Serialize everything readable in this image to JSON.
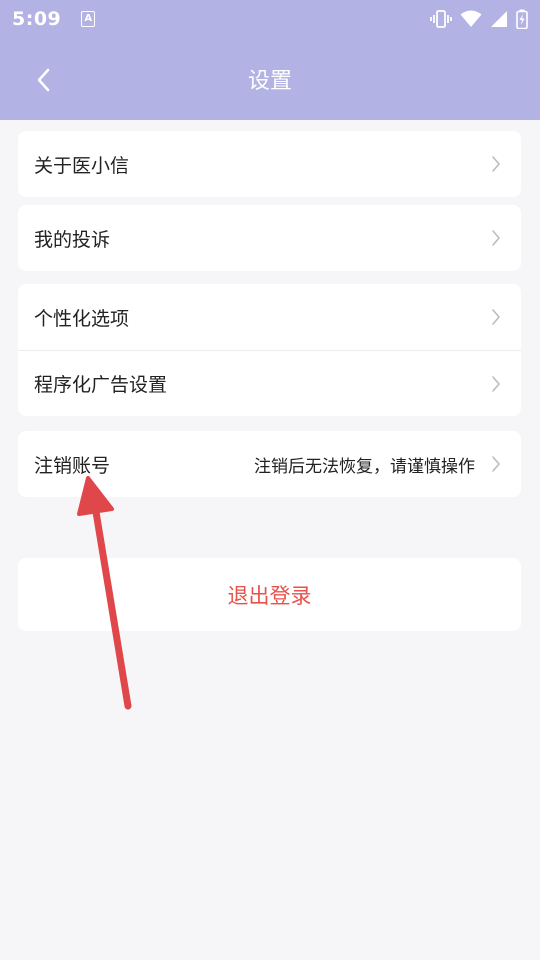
{
  "status_bar": {
    "time": "5:09",
    "notification_icon": "a-badge-icon",
    "icons": [
      "vibrate-icon",
      "wifi-icon",
      "signal-icon",
      "battery-charging-icon"
    ]
  },
  "app_bar": {
    "back_icon": "chevron-left-icon",
    "title": "设置"
  },
  "groups": [
    {
      "items": [
        {
          "label": "关于医小信"
        }
      ]
    },
    {
      "items": [
        {
          "label": "我的投诉"
        }
      ]
    },
    {
      "items": [
        {
          "label": "个性化选项"
        },
        {
          "label": "程序化广告设置"
        }
      ]
    },
    {
      "items": [
        {
          "label": "注销账号",
          "hint": "注销后无法恢复，请谨慎操作"
        }
      ]
    }
  ],
  "logout_label": "退出登录",
  "colors": {
    "header": "#b2b2e4",
    "background": "#f6f6f8",
    "logout_text": "#e5534b",
    "annotation_arrow": "#e0474a"
  },
  "annotation": {
    "type": "arrow",
    "icon": "red-arrow-icon"
  }
}
